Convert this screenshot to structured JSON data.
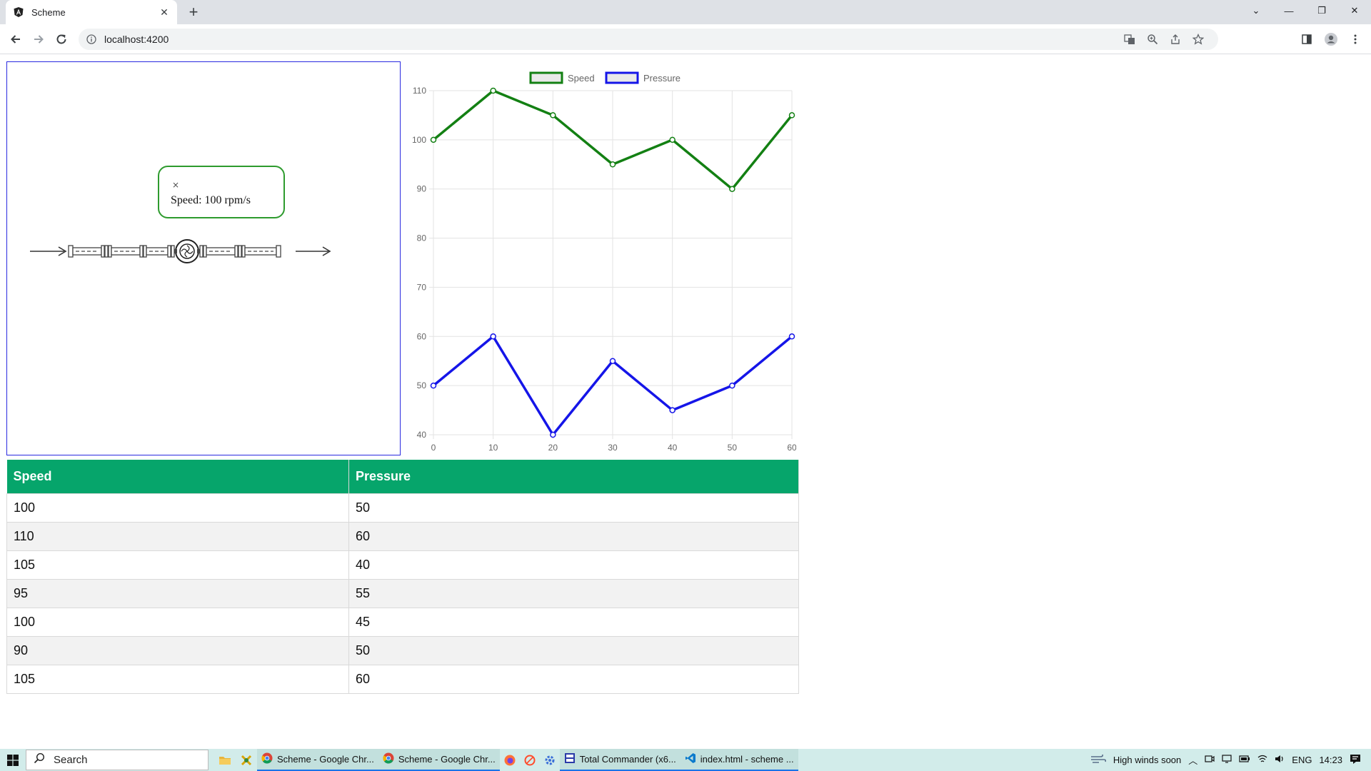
{
  "browser": {
    "tab_title": "Scheme",
    "url": "localhost:4200"
  },
  "scheme": {
    "tooltip_close": "×",
    "tooltip_text": "Speed: 100 rpm/s"
  },
  "chart_data": {
    "type": "line",
    "x": [
      0,
      10,
      20,
      30,
      40,
      50,
      60
    ],
    "series": [
      {
        "name": "Speed",
        "values": [
          100,
          110,
          105,
          95,
          100,
          90,
          105
        ],
        "color": "#138013"
      },
      {
        "name": "Pressure",
        "values": [
          50,
          60,
          40,
          55,
          45,
          50,
          60
        ],
        "color": "#1515e8"
      }
    ],
    "ylim": [
      40,
      110
    ],
    "yticks": [
      40,
      50,
      60,
      70,
      80,
      90,
      100,
      110
    ],
    "xlim": [
      0,
      60
    ],
    "grid": true,
    "legend": "top"
  },
  "table": {
    "headers": [
      "Speed",
      "Pressure"
    ],
    "rows": [
      [
        "100",
        "50"
      ],
      [
        "110",
        "60"
      ],
      [
        "105",
        "40"
      ],
      [
        "95",
        "55"
      ],
      [
        "100",
        "45"
      ],
      [
        "90",
        "50"
      ],
      [
        "105",
        "60"
      ]
    ]
  },
  "taskbar": {
    "search_label": "Search",
    "apps": [
      {
        "label": "Scheme - Google Chr..."
      },
      {
        "label": "Scheme - Google Chr..."
      },
      {
        "label": "Total Commander (x6..."
      },
      {
        "label": "index.html - scheme ..."
      }
    ],
    "weather": "High winds soon",
    "lang": "ENG",
    "time": "14:23"
  }
}
